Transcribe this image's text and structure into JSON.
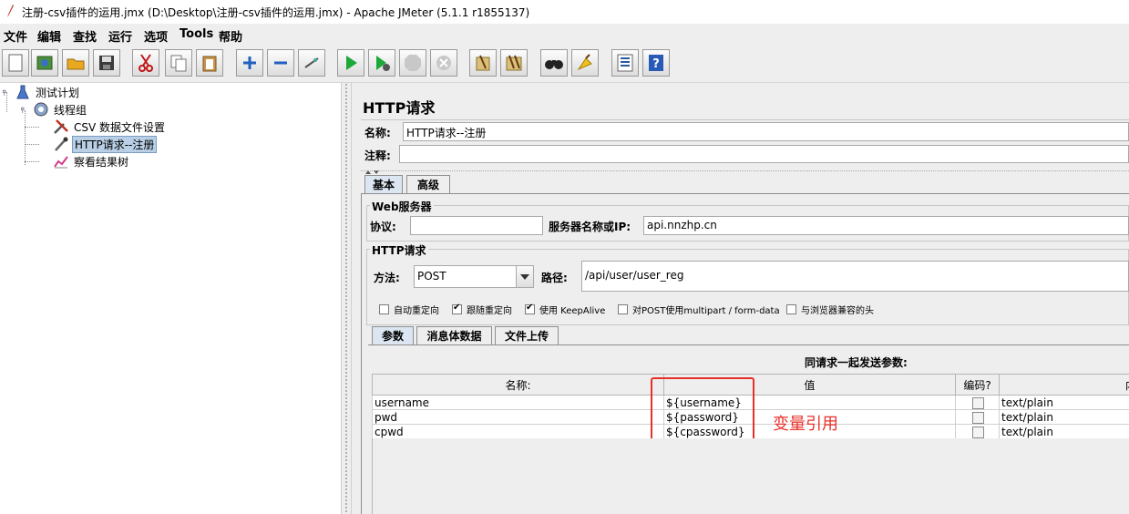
{
  "window": {
    "title": "注册-csv插件的运用.jmx (D:\\Desktop\\注册-csv插件的运用.jmx) - Apache JMeter (5.1.1 r1855137)"
  },
  "menu": [
    "文件",
    "编辑",
    "查找",
    "运行",
    "选项",
    "Tools",
    "帮助"
  ],
  "toolbar_icons": [
    "new-icon",
    "templates-icon",
    "open-icon",
    "save-icon",
    "cut-icon",
    "copy-icon",
    "paste-icon",
    "expand-icon",
    "collapse-icon",
    "toggle-icon",
    "start-icon",
    "start-no-pause-icon",
    "stop-icon",
    "shutdown-icon",
    "clear-icon",
    "clear-all-icon",
    "search-icon",
    "reset-search-icon",
    "function-helper-icon",
    "help-icon"
  ],
  "tree": {
    "items": [
      {
        "label": "测试计划",
        "icon": "flask-icon"
      },
      {
        "label": "线程组",
        "icon": "gear-icon"
      },
      {
        "label": "CSV 数据文件设置",
        "icon": "wrench-icon"
      },
      {
        "label": "HTTP请求--注册",
        "icon": "pipette-icon"
      },
      {
        "label": "察看结果树",
        "icon": "chart-icon"
      }
    ],
    "selected_index": 3
  },
  "panel": {
    "title": "HTTP请求",
    "name_label": "名称:",
    "name_value": "HTTP请求--注册",
    "comment_label": "注释:",
    "comment_value": "",
    "tabs": [
      "基本",
      "高级"
    ],
    "web_server": {
      "title": "Web服务器",
      "protocol_label": "协议:",
      "protocol_value": "",
      "server_label": "服务器名称或IP:",
      "server_value": "api.nnzhp.cn"
    },
    "http_request": {
      "title": "HTTP请求",
      "method_label": "方法:",
      "method_value": "POST",
      "path_label": "路径:",
      "path_value": "/api/user/user_reg"
    },
    "options": [
      {
        "label": "自动重定向",
        "checked": false
      },
      {
        "label": "跟随重定向",
        "checked": true
      },
      {
        "label": "使用 KeepAlive",
        "checked": true
      },
      {
        "label": "对POST使用multipart / form-data",
        "checked": false
      },
      {
        "label": "与浏览器兼容的头",
        "checked": false
      }
    ],
    "sub_tabs": [
      "参数",
      "消息体数据",
      "文件上传"
    ],
    "params_header": "同请求一起发送参数:",
    "columns": [
      "名称:",
      "值",
      "编码?",
      "内"
    ],
    "rows": [
      {
        "name": "username",
        "value": "${username}",
        "content_type": "text/plain"
      },
      {
        "name": "pwd",
        "value": "${password}",
        "content_type": "text/plain"
      },
      {
        "name": "cpwd",
        "value": "${cpassword}",
        "content_type": "text/plain"
      }
    ]
  },
  "annotation": {
    "text": "变量引用",
    "color": "#e8302a"
  },
  "colors": {
    "accent_red": "#e8302a",
    "selection": "#b8cfe5",
    "tab_active": "#dbe6f2"
  }
}
